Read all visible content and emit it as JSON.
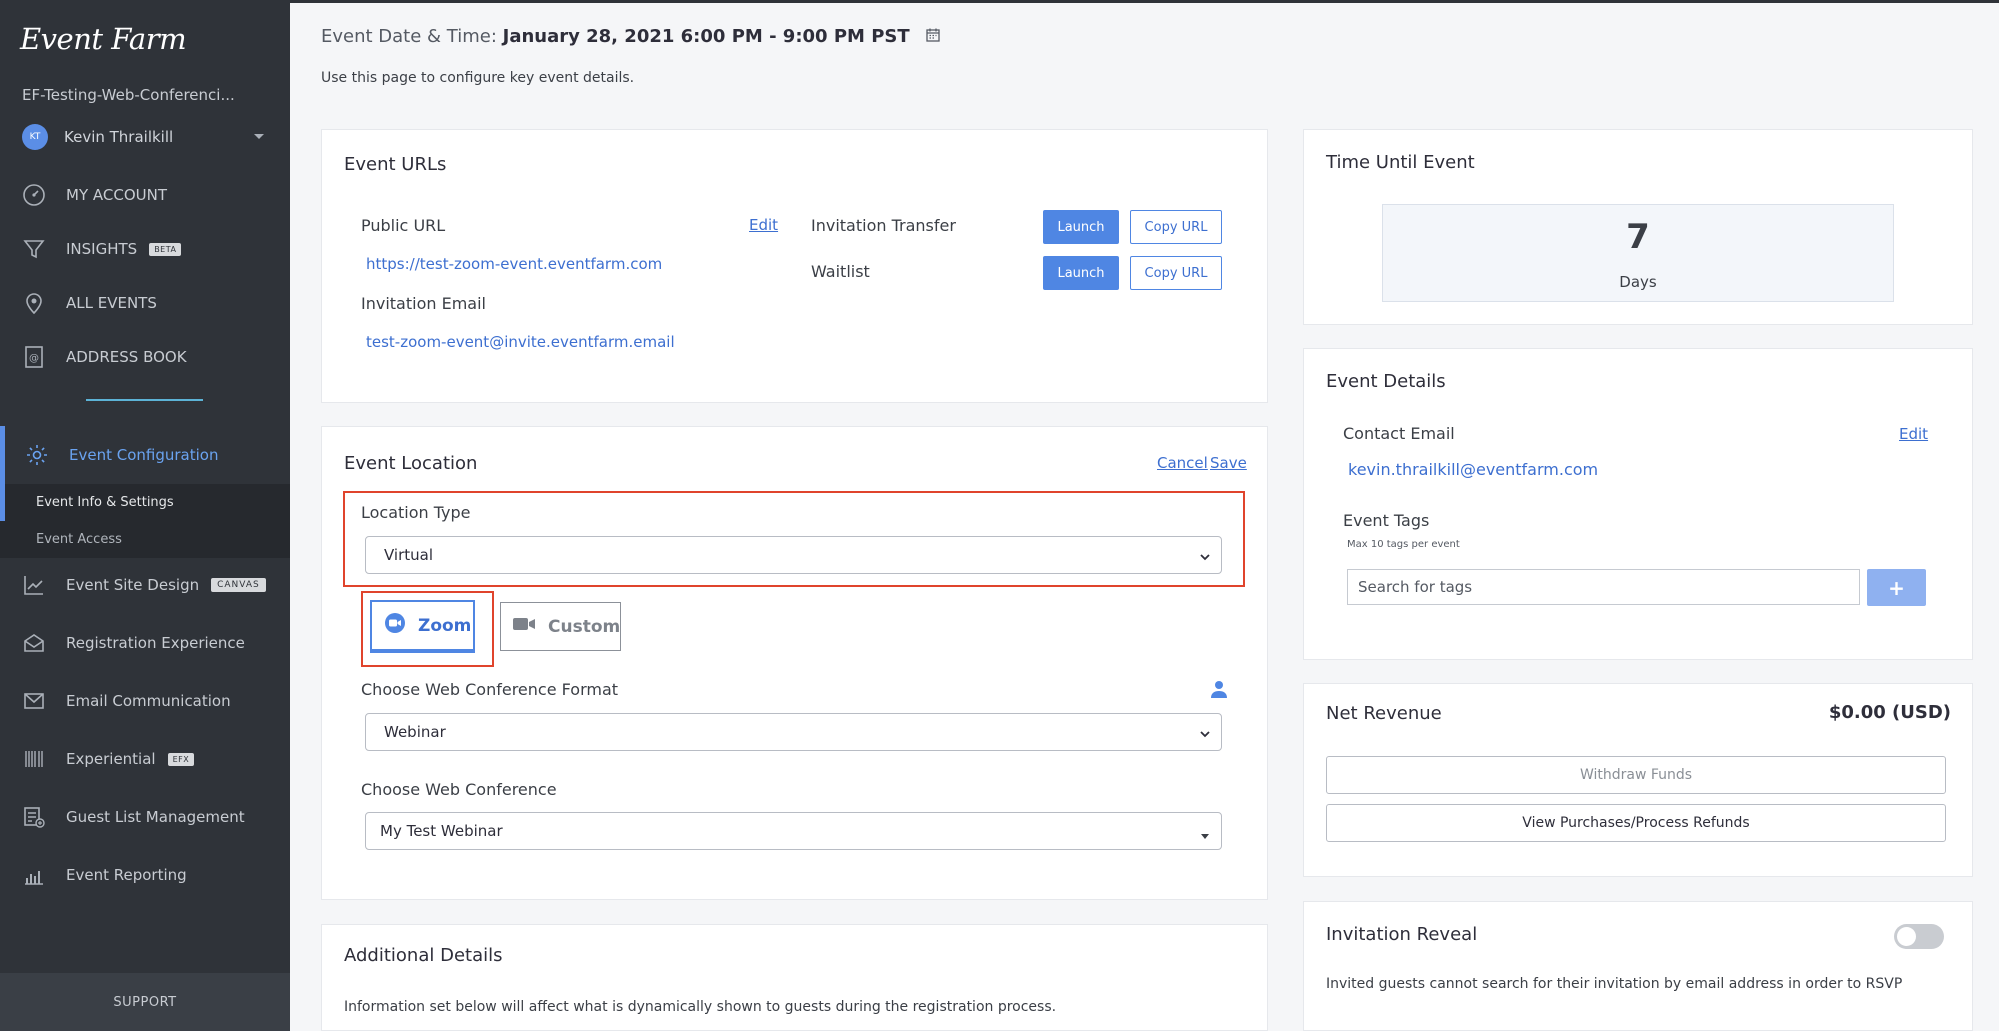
{
  "sidebar": {
    "logo": "Event Farm",
    "org_name": "EF-Testing-Web-Conferenci...",
    "user": {
      "initials": "KT",
      "name": "Kevin Thrailkill"
    },
    "top_items": [
      {
        "label": "MY ACCOUNT",
        "icon": "gauge-icon"
      },
      {
        "label": "INSIGHTS",
        "icon": "funnel-icon",
        "badge": "BETA"
      },
      {
        "label": "ALL EVENTS",
        "icon": "map-pin-icon"
      },
      {
        "label": "ADDRESS BOOK",
        "icon": "address-book-icon"
      }
    ],
    "active_item": {
      "label": "Event Configuration",
      "icon": "gear-icon"
    },
    "sub_items": [
      {
        "label": "Event Info & Settings",
        "active": true
      },
      {
        "label": "Event Access",
        "active": false
      }
    ],
    "bottom_items": [
      {
        "label": "Event Site Design",
        "icon": "chart-line-icon",
        "badge": "CANVAS"
      },
      {
        "label": "Registration Experience",
        "icon": "envelope-open-icon"
      },
      {
        "label": "Email Communication",
        "icon": "envelope-icon"
      },
      {
        "label": "Experiential",
        "icon": "barcode-icon",
        "badge": "EFX"
      },
      {
        "label": "Guest List Management",
        "icon": "list-add-icon"
      },
      {
        "label": "Event Reporting",
        "icon": "bar-chart-icon"
      }
    ],
    "support": "SUPPORT"
  },
  "header": {
    "date_label": "Event Date & Time: ",
    "date_value": "January 28, 2021 6:00 PM - 9:00 PM PST",
    "description": "Use this page to configure key event details."
  },
  "event_urls": {
    "title": "Event URLs",
    "public_url_label": "Public URL",
    "edit": "Edit",
    "public_url": "https://test-zoom-event.eventfarm.com",
    "invitation_email_label": "Invitation Email",
    "invitation_email": "test-zoom-event@invite.eventfarm.email",
    "rows": [
      {
        "label": "Invitation Transfer",
        "launch": "Launch",
        "copy": "Copy URL"
      },
      {
        "label": "Waitlist",
        "launch": "Launch",
        "copy": "Copy URL"
      }
    ]
  },
  "event_location": {
    "title": "Event Location",
    "cancel": "Cancel",
    "save": "Save",
    "location_type_label": "Location Type",
    "location_type_value": "Virtual",
    "providers": [
      {
        "label": "Zoom",
        "icon": "zoom-icon"
      },
      {
        "label": "Custom",
        "icon": "video-camera-icon"
      }
    ],
    "format_label": "Choose Web Conference Format",
    "format_value": "Webinar",
    "conference_label": "Choose Web Conference",
    "conference_value": "My Test Webinar"
  },
  "additional_details": {
    "title": "Additional Details",
    "description": "Information set below will affect what is dynamically shown to guests during the registration process."
  },
  "time_until": {
    "title": "Time Until Event",
    "value": "7",
    "unit": "Days"
  },
  "event_details": {
    "title": "Event Details",
    "contact_label": "Contact Email",
    "edit": "Edit",
    "contact_email": "kevin.thrailkill@eventfarm.com",
    "tags_label": "Event Tags",
    "tags_hint": "Max 10 tags per event",
    "tags_placeholder": "Search for tags",
    "add": "+"
  },
  "net_revenue": {
    "title": "Net Revenue",
    "amount": "$0.00 (USD)",
    "withdraw": "Withdraw Funds",
    "view_purchases": "View Purchases/Process Refunds"
  },
  "invitation_reveal": {
    "title": "Invitation Reveal",
    "enabled": false,
    "description": "Invited guests cannot search for their invitation by email address in order to RSVP"
  },
  "colors": {
    "sidebar_bg": "#2f3339",
    "accent_blue": "#4f86e3",
    "highlight_red": "#e0442c"
  }
}
